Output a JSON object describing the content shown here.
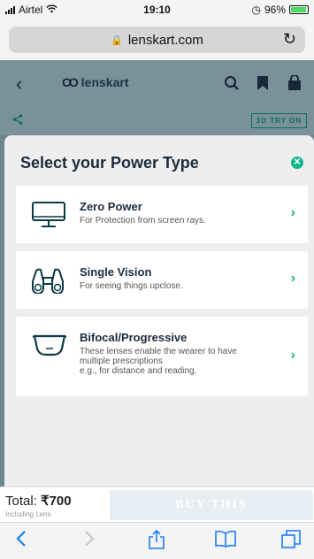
{
  "status_bar": {
    "carrier": "Airtel",
    "time": "19:10",
    "battery_percent": "96%",
    "battery_level": 0.96
  },
  "browser": {
    "url": "lenskart.com"
  },
  "site": {
    "brand": "lenskart",
    "try_on_label": "3D TRY ON"
  },
  "modal": {
    "title": "Select your Power Type",
    "options": [
      {
        "title": "Zero Power",
        "description": "For Protection from screen rays.",
        "icon": "monitor-icon"
      },
      {
        "title": "Single Vision",
        "description": "For seeing things upclose.",
        "icon": "binoculars-icon"
      },
      {
        "title": "Bifocal/Progressive",
        "description_lines": [
          "These lenses enable the wearer to have",
          "multiple prescriptions",
          "e.g., for distance and reading."
        ],
        "icon": "glasses-icon"
      }
    ]
  },
  "footer": {
    "total_label": "Total:",
    "total_value": "₹700",
    "total_sub": "Including Lens",
    "buy_label": "BUY THIS"
  },
  "colors": {
    "accent": "#16b78d",
    "ios_blue": "#1a7cf5",
    "dim_overlay": "#6e8690"
  }
}
